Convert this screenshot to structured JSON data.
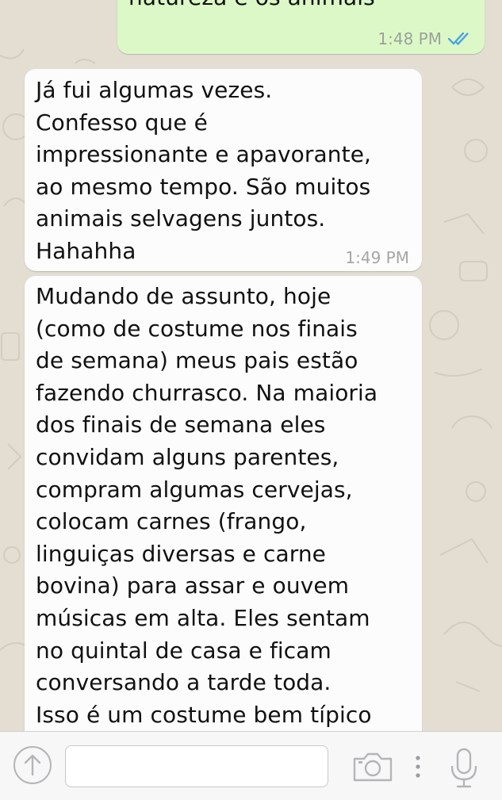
{
  "messages": [
    {
      "direction": "outgoing",
      "text": "natureza e os animais",
      "time": "1:48 PM",
      "status": "read"
    },
    {
      "direction": "incoming",
      "text": "Já fui algumas vezes.\nConfesso que é\nimpressionante e apavorante,\nao mesmo tempo. São muitos\nanimais selvagens juntos.\nHahahha",
      "time": "1:49 PM"
    },
    {
      "direction": "incoming",
      "text": "Mudando de assunto, hoje\n(como de costume nos finais\nde semana) meus pais estão\nfazendo churrasco. Na maioria\ndos finais de semana eles\nconvidam alguns parentes,\ncompram algumas cervejas,\ncolocam carnes (frango,\nlinguiças diversas e carne\nbovina) para assar e ouvem\nmúsicas em alta. Eles sentam\nno quintal de casa e ficam\nconversando a tarde toda.\nIsso é um costume bem típico"
    }
  ],
  "composer": {
    "value": "",
    "icons": [
      "attach-arrow-up-icon",
      "camera-icon",
      "more-vertical-icon",
      "microphone-icon"
    ]
  },
  "colors": {
    "chat_background": "#e3ddd2",
    "outgoing_bubble": "#dcf8c7",
    "incoming_bubble": "#fcfcfc",
    "read_ticks": "#4fa3e0",
    "icon_gray": "#b5b5b8"
  }
}
